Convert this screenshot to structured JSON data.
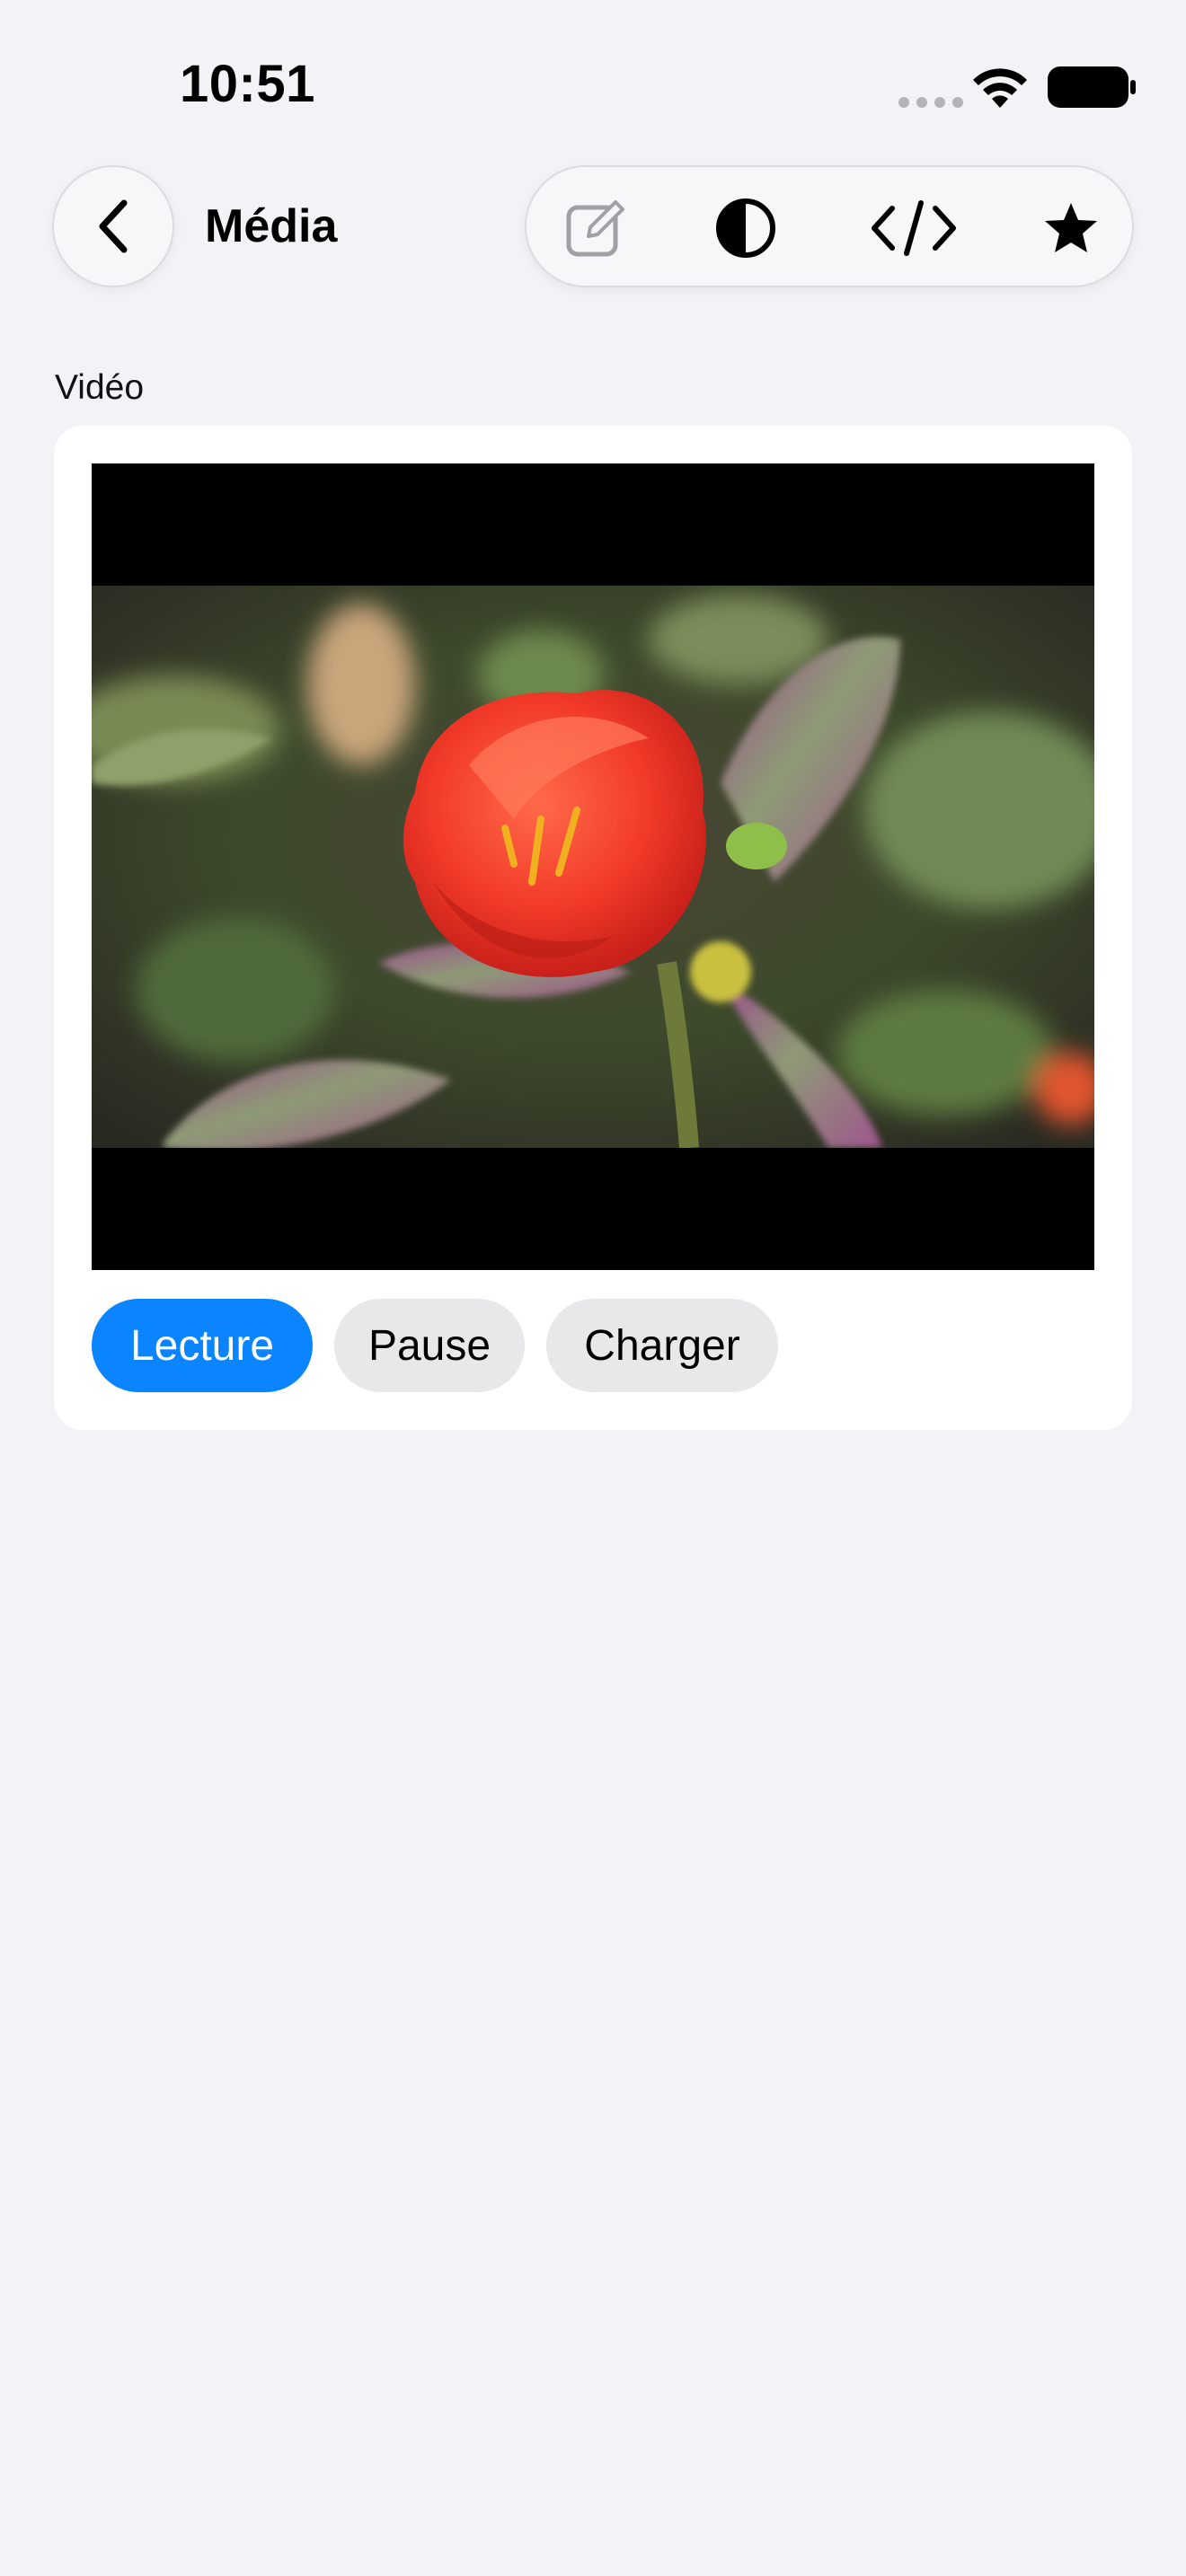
{
  "status": {
    "time": "10:51",
    "icons": [
      "cellular-signal-icon",
      "wifi-icon",
      "battery-icon"
    ]
  },
  "nav": {
    "back_icon": "chevron-left-icon",
    "title": "Média",
    "tools": [
      {
        "name": "compose-icon",
        "enabled": false
      },
      {
        "name": "contrast-icon",
        "enabled": true
      },
      {
        "name": "code-icon",
        "enabled": true
      },
      {
        "name": "star-icon",
        "enabled": true
      }
    ]
  },
  "section": {
    "label": "Vidéo"
  },
  "video": {
    "content": "red flower close-up"
  },
  "buttons": {
    "play": "Lecture",
    "pause": "Pause",
    "load": "Charger"
  },
  "colors": {
    "background": "#f2f2f7",
    "accent": "#0a84ff",
    "card": "#ffffff",
    "secondary_button": "#e8e8eb"
  }
}
